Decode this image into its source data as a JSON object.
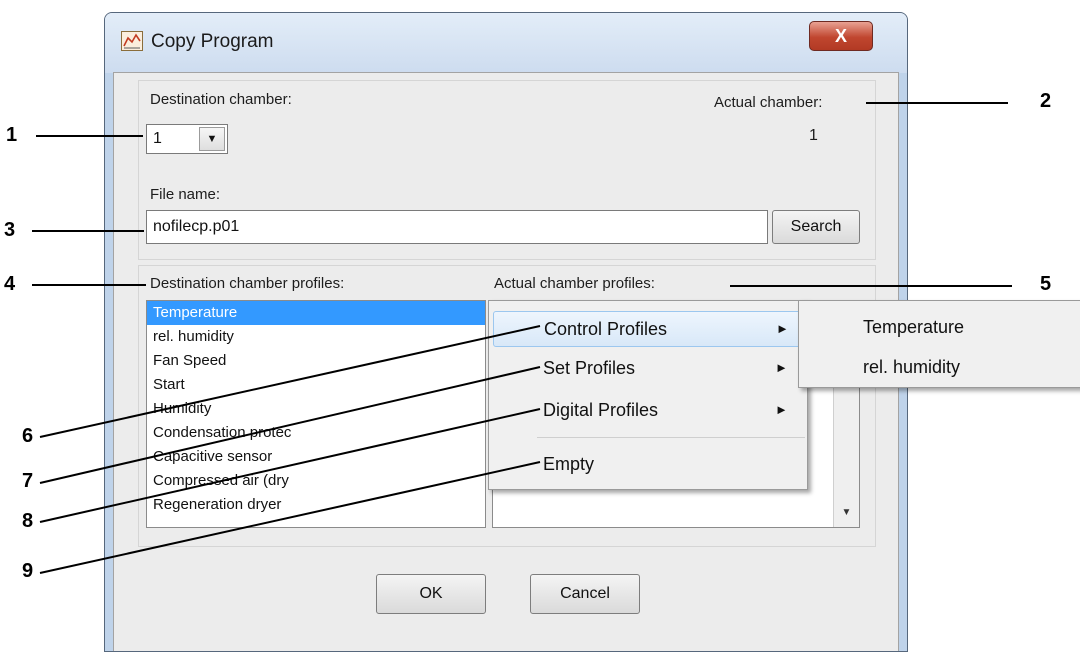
{
  "window": {
    "title": "Copy Program",
    "close_glyph": "X"
  },
  "chamber": {
    "destination_label": "Destination chamber:",
    "destination_value": "1",
    "actual_label": "Actual chamber:",
    "actual_value": "1"
  },
  "file": {
    "label": "File name:",
    "value": "nofilecp.p01",
    "search_label": "Search"
  },
  "profiles": {
    "destination_label": "Destination chamber profiles:",
    "actual_label": "Actual chamber profiles:",
    "destination_items": [
      "Temperature",
      "rel. humidity",
      "Fan Speed",
      "Start",
      "Humidity",
      "Condensation protec",
      "Capacitive sensor",
      "Compressed air (dry",
      "Regeneration dryer"
    ],
    "selected_index": 0
  },
  "context_menu": {
    "items": [
      "Control Profiles",
      "Set Profiles",
      "Digital Profiles",
      "Empty"
    ],
    "submenu_arrow": "►",
    "submenu_items": [
      "Temperature",
      "rel. humidity"
    ]
  },
  "buttons": {
    "ok": "OK",
    "cancel": "Cancel"
  },
  "callouts": [
    "1",
    "2",
    "3",
    "4",
    "5",
    "6",
    "7",
    "8",
    "9"
  ],
  "icons": {
    "app": "program-chart-icon",
    "dropdown": "chevron-down-icon",
    "submenu": "chevron-right-icon",
    "scroll": "scroll-down-arrow-icon"
  },
  "colors": {
    "selection": "#3399ff",
    "close_button": "#c0462f",
    "menu_highlight": "#d8e8f8"
  }
}
